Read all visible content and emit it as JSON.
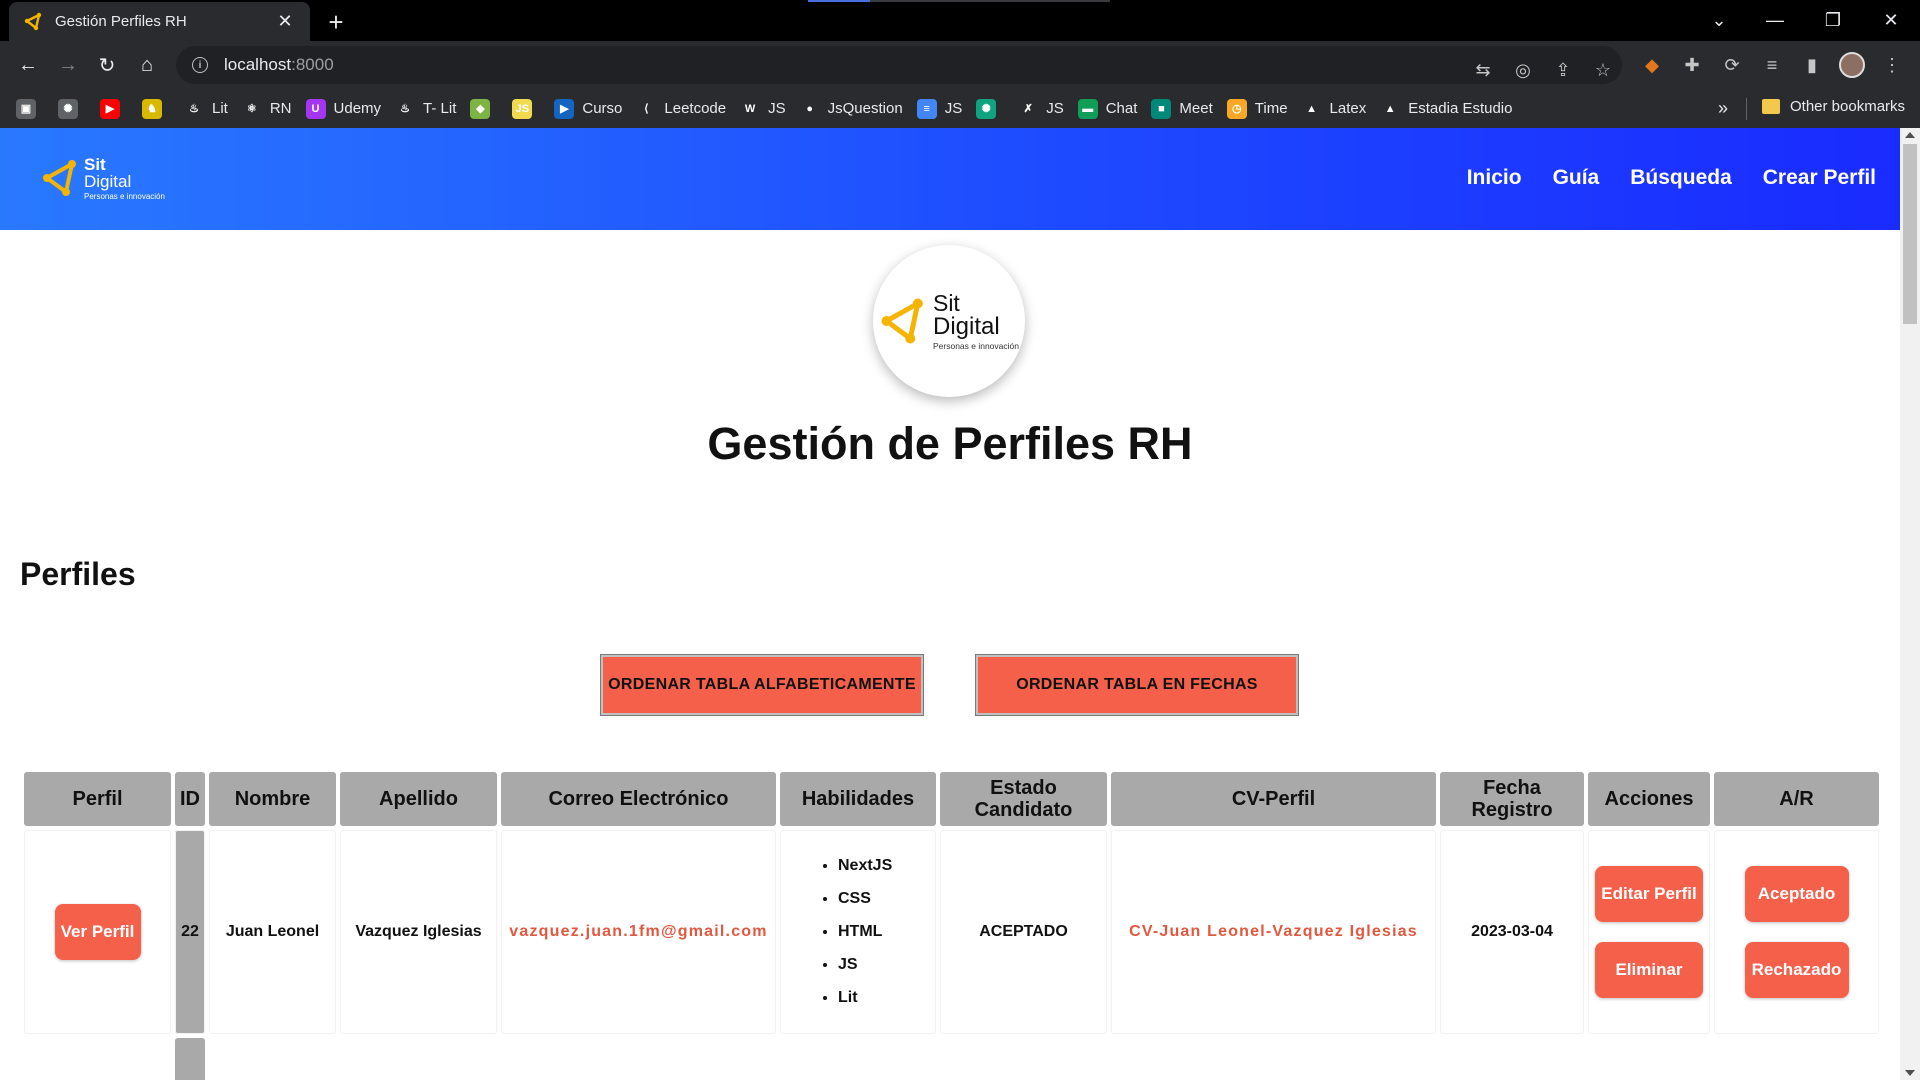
{
  "browser": {
    "tab_title": "Gestión Perfiles RH",
    "url_host": "localhost",
    "url_port": ":8000",
    "bookmarks": [
      {
        "label": "",
        "icon": "save-page-icon",
        "color": "#5f6368"
      },
      {
        "label": "",
        "icon": "chatgpt-icon",
        "color": "#5f6368"
      },
      {
        "label": "",
        "icon": "youtube-icon",
        "color": "#ff0000"
      },
      {
        "label": "",
        "icon": "chess-icon",
        "color": "#d9b800"
      },
      {
        "label": "Lit",
        "icon": "lit-flame-icon",
        "color": "#2a2b2e"
      },
      {
        "label": "RN",
        "icon": "react-native-icon",
        "color": "#2a2b2e"
      },
      {
        "label": "Udemy",
        "icon": "udemy-icon",
        "color": "#a435f0"
      },
      {
        "label": "T- Lit",
        "icon": "lit-flame-icon",
        "color": "#2a2b2e"
      },
      {
        "label": "",
        "icon": "diamond-icon",
        "color": "#7cb342"
      },
      {
        "label": "",
        "icon": "js-icon",
        "color": "#f0db4f"
      },
      {
        "label": "Curso",
        "icon": "play-icon",
        "color": "#1565c0"
      },
      {
        "label": "Leetcode",
        "icon": "leetcode-icon",
        "color": "#2a2b2e"
      },
      {
        "label": "JS",
        "icon": "w-icon",
        "color": "#2a2b2e"
      },
      {
        "label": "JsQuestion",
        "icon": "github-icon",
        "color": "#2a2b2e"
      },
      {
        "label": "JS",
        "icon": "docs-icon",
        "color": "#4285f4"
      },
      {
        "label": "",
        "icon": "openai-icon",
        "color": "#10a37f"
      },
      {
        "label": "JS",
        "icon": "x-icon",
        "color": "#2a2b2e"
      },
      {
        "label": "Chat",
        "icon": "chat-icon",
        "color": "#0f9d58"
      },
      {
        "label": "Meet",
        "icon": "meet-icon",
        "color": "#00897b"
      },
      {
        "label": "Time",
        "icon": "clock-icon",
        "color": "#f9a825"
      },
      {
        "label": "Latex",
        "icon": "drive-icon",
        "color": "#2a2b2e"
      },
      {
        "label": "Estadia Estudio",
        "icon": "drive-icon",
        "color": "#2a2b2e"
      }
    ],
    "bookmarks_more": "»",
    "other_bookmarks": "Other bookmarks"
  },
  "header": {
    "logo": {
      "sit": "Sit",
      "digital": "Digital",
      "tagline": "Personas e innovación"
    },
    "nav": [
      "Inicio",
      "Guía",
      "Búsqueda",
      "Crear Perfil"
    ]
  },
  "main": {
    "title": "Gestión de Perfiles RH",
    "section_title": "Perfiles",
    "sort_alpha_label": "ORDENAR TABLA ALFABETICAMENTE",
    "sort_date_label": "ORDENAR TABLA EN FECHAS"
  },
  "table": {
    "headers": [
      "Perfil",
      "ID",
      "Nombre",
      "Apellido",
      "Correo Electrónico",
      "Habilidades",
      "Estado Candidato",
      "CV-Perfil",
      "Fecha Registro",
      "Acciones",
      "A/R"
    ],
    "rows": [
      {
        "view_label": "Ver Perfil",
        "id": "22",
        "nombre": "Juan Leonel",
        "apellido": "Vazquez Iglesias",
        "correo": "vazquez.juan.1fm@gmail.com",
        "habilidades": [
          "NextJS",
          "CSS",
          "HTML",
          "JS",
          "Lit"
        ],
        "estado": "ACEPTADO",
        "cv": "CV-Juan Leonel-Vazquez Iglesias",
        "fecha": "2023-03-04",
        "edit_label": "Editar Perfil",
        "delete_label": "Eliminar",
        "accept_label": "Aceptado",
        "reject_label": "Rechazado"
      }
    ]
  },
  "colors": {
    "accent_red": "#f5604b",
    "header_gradient_start": "#2979ff",
    "header_gradient_end": "#1a2bff",
    "table_header_gray": "#a9a9a9"
  }
}
